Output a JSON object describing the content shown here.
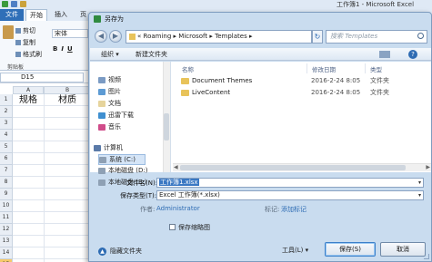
{
  "excel": {
    "title": "工作簿1 - Microsoft Excel",
    "file_tab": "文件",
    "tabs": [
      "开始",
      "插入",
      "页"
    ],
    "clipboard": {
      "cut": "剪切",
      "copy": "复制",
      "format_painter": "格式刷",
      "group": "剪贴板"
    },
    "font_name": "宋体",
    "format_buttons": [
      "B",
      "I",
      "U"
    ],
    "name_box": "D15",
    "columns": [
      "A",
      "B"
    ],
    "header_cells": [
      "规格",
      "材质"
    ],
    "rows": [
      "1",
      "2",
      "3",
      "4",
      "5",
      "6",
      "7",
      "8",
      "9",
      "10",
      "11",
      "12",
      "13",
      "14",
      "15"
    ]
  },
  "dialog": {
    "title": "另存为",
    "breadcrumb": [
      "«",
      "Roaming",
      "▸",
      "Microsoft",
      "▸",
      "Templates",
      "▸"
    ],
    "search_placeholder": "搜索 Templates",
    "toolbar": {
      "organize": "组织 ▾",
      "new_folder": "新建文件夹"
    },
    "nav_items": [
      {
        "label": "视频",
        "icon": "video-icon"
      },
      {
        "label": "图片",
        "icon": "picture-icon"
      },
      {
        "label": "文档",
        "icon": "document-icon"
      },
      {
        "label": "迅雷下载",
        "icon": "download-icon"
      },
      {
        "label": "音乐",
        "icon": "music-icon"
      },
      {
        "label": "计算机",
        "icon": "computer-icon"
      },
      {
        "label": "系统 (C:)",
        "icon": "drive-icon"
      },
      {
        "label": "本地磁盘 (D:)",
        "icon": "drive-icon"
      },
      {
        "label": "本地磁盘 (E:)",
        "icon": "drive-icon"
      }
    ],
    "columns": {
      "name": "名称",
      "modified": "修改日期",
      "type": "类型"
    },
    "files": [
      {
        "name": "Document Themes",
        "modified": "2016-2-24 8:05",
        "type": "文件夹"
      },
      {
        "name": "LiveContent",
        "modified": "2016-2-24 8:05",
        "type": "文件夹"
      }
    ],
    "filename_label": "文件名(N):",
    "filename_value": "工作簿1.xlsx",
    "filetype_label": "保存类型(T):",
    "filetype_value": "Excel 工作簿(*.xlsx)",
    "author_label": "作者:",
    "author_value": "Administrator",
    "tags_label": "标记:",
    "tags_value": "添加标记",
    "thumbnail_label": "保存缩略图",
    "hide_folders": "隐藏文件夹",
    "tools_label": "工具(L)",
    "tools_arrow": "▾",
    "save_button": "保存(S)",
    "cancel_button": "取消"
  }
}
